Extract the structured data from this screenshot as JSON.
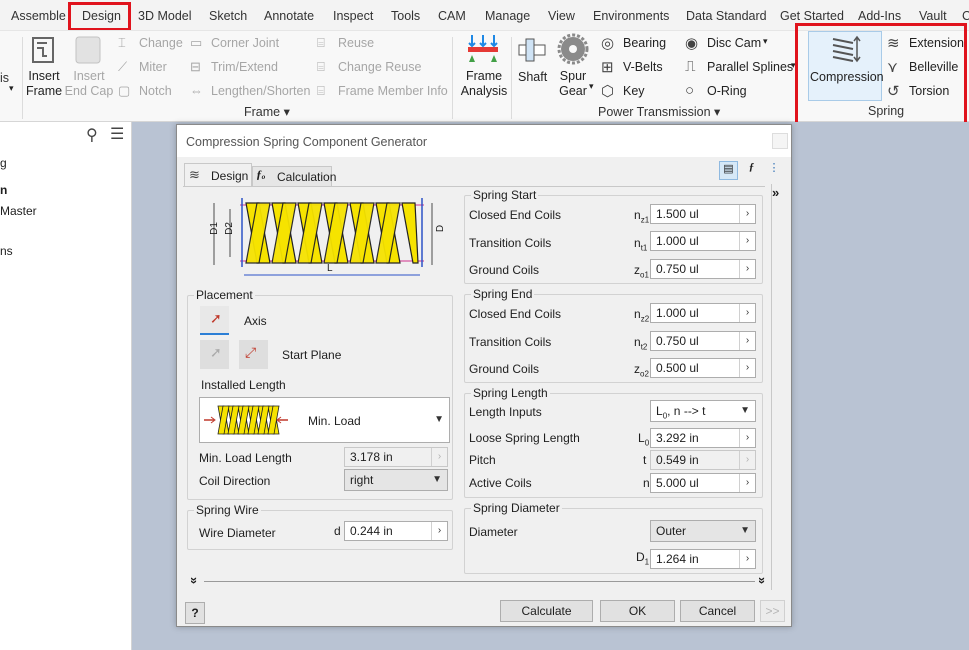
{
  "ribbon_tabs": [
    "Assemble",
    "Design",
    "3D Model",
    "Sketch",
    "Annotate",
    "Inspect",
    "Tools",
    "CAM",
    "Manage",
    "View",
    "Environments",
    "Data Standard",
    "Get Started",
    "Add-Ins",
    "Vault",
    "C"
  ],
  "ribbon": {
    "insert_frame": "Insert\nFrame",
    "insert_end_cap": "Insert\nEnd Cap",
    "change": "Change",
    "miter": "Miter",
    "notch": "Notch",
    "corner_joint": "Corner Joint",
    "trim_extend": "Trim/Extend",
    "lengthen_shorten": "Lengthen/Shorten",
    "reuse": "Reuse",
    "change_reuse": "Change Reuse",
    "frame_member_info": "Frame Member Info",
    "frame_group": "Frame ▾",
    "frame_analysis": "Frame\nAnalysis",
    "shaft": "Shaft",
    "spur_gear": "Spur\nGear",
    "bearing": "Bearing",
    "v_belts": "V-Belts",
    "key": "Key",
    "disc_cam": "Disc Cam",
    "parallel_splines": "Parallel Splines",
    "o_ring": "O-Ring",
    "power_transmission_group": "Power Transmission ▾",
    "compression": "Compression",
    "extension": "Extension",
    "belleville": "Belleville",
    "torsion": "Torsion",
    "spring_group": "Spring",
    "left_cut": "is",
    "accent_red": "#e0131d"
  },
  "browser": {
    "items": [
      "g",
      "n",
      "Master",
      "ns"
    ]
  },
  "dialog": {
    "title": "Compression Spring Component Generator",
    "tab_design": "Design",
    "tab_calculation": "Calculation",
    "diagram": {
      "d1": "D1",
      "d2": "D2",
      "d": "D",
      "l": "L"
    },
    "placement": {
      "title": "Placement",
      "axis": "Axis",
      "start_plane": "Start Plane",
      "installed_length": "Installed Length",
      "min_load": "Min. Load",
      "min_load_length_label": "Min. Load Length",
      "min_load_length_value": "3.178 in",
      "coil_direction_label": "Coil Direction",
      "coil_direction_value": "right"
    },
    "spring_wire": {
      "title": "Spring Wire",
      "wire_diameter_label": "Wire Diameter",
      "wire_diameter_sym": "d",
      "wire_diameter_value": "0.244 in"
    },
    "spring_start": {
      "title": "Spring Start",
      "closed_end_coils": "Closed End Coils",
      "closed_sym": "n",
      "closed_sub": "z1",
      "closed_value": "1.500 ul",
      "transition_coils": "Transition Coils",
      "trans_sym": "n",
      "trans_sub": "t1",
      "trans_value": "1.000 ul",
      "ground_coils": "Ground Coils",
      "ground_sym": "z",
      "ground_sub": "o1",
      "ground_value": "0.750 ul"
    },
    "spring_end": {
      "title": "Spring End",
      "closed_end_coils": "Closed End Coils",
      "closed_sym": "n",
      "closed_sub": "z2",
      "closed_value": "1.000 ul",
      "transition_coils": "Transition Coils",
      "trans_sym": "n",
      "trans_sub": "t2",
      "trans_value": "0.750 ul",
      "ground_coils": "Ground Coils",
      "ground_sym": "z",
      "ground_sub": "o2",
      "ground_value": "0.500 ul"
    },
    "spring_length": {
      "title": "Spring Length",
      "length_inputs_label": "Length Inputs",
      "length_inputs_value_main": "L",
      "length_inputs_value_sub": "0",
      "length_inputs_value_rest": ", n --> t",
      "loose_label": "Loose Spring Length",
      "loose_sym": "L",
      "loose_sub": "0",
      "loose_value": "3.292 in",
      "pitch_label": "Pitch",
      "pitch_sym": "t",
      "pitch_value": "0.549 in",
      "active_label": "Active Coils",
      "active_sym": "n",
      "active_value": "5.000 ul"
    },
    "spring_diameter": {
      "title": "Spring Diameter",
      "diameter_label": "Diameter",
      "diameter_value": "Outer",
      "d1_sym": "D",
      "d1_sub": "1",
      "d1_value": "1.264 in"
    },
    "buttons": {
      "help": "?",
      "calculate": "Calculate",
      "ok": "OK",
      "cancel": "Cancel",
      "more": ">>",
      "expand_right": "»",
      "expand_down": "»"
    }
  }
}
